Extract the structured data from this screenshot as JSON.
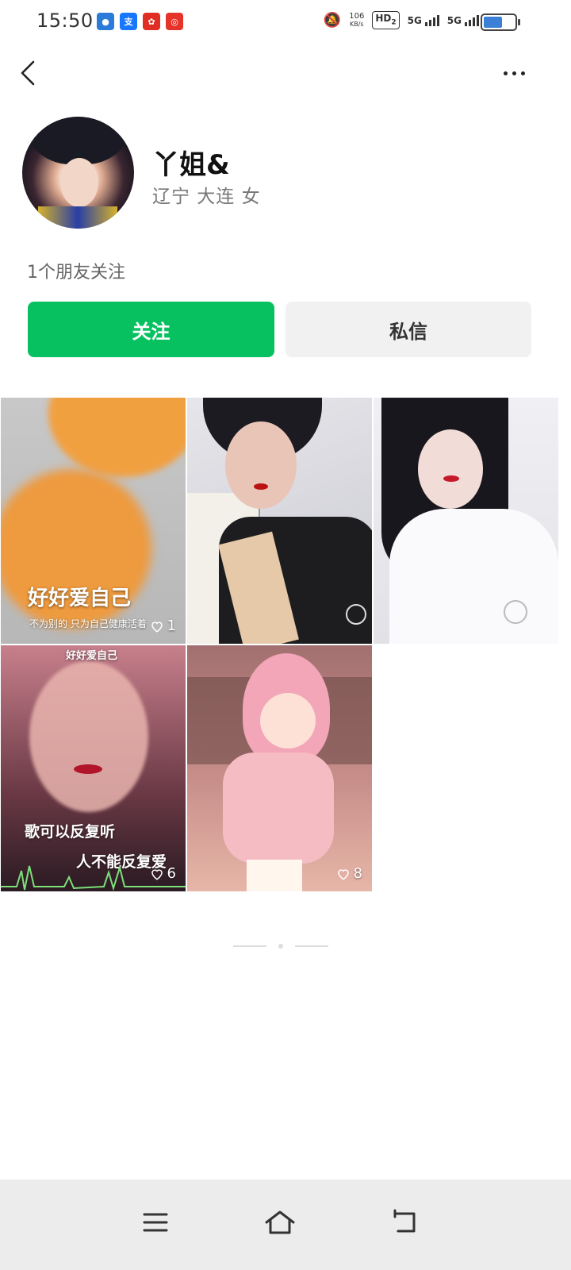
{
  "status_bar": {
    "time": "15:50",
    "net_speed_value": "106",
    "net_speed_unit": "KB/s",
    "hd_label": "HD",
    "hd_sub": "2",
    "signal1_label": "5G",
    "signal2_label": "5G",
    "battery_level": 0.65
  },
  "header": {
    "back_icon": "chevron-left-icon",
    "more_icon": "more-dots-icon"
  },
  "profile": {
    "name": "丫姐&",
    "location": "辽宁 大连 女",
    "friends_follow": "1个朋友关注",
    "follow_label": "关注",
    "message_label": "私信"
  },
  "posts": [
    {
      "caption_main": "好好爱自己",
      "caption_sub": "不为别的 只为自己健康活着",
      "likes": "1"
    },
    {
      "caption_main": "",
      "caption_sub": "",
      "likes": ""
    },
    {
      "caption_main": "",
      "caption_sub": "",
      "likes": ""
    },
    {
      "caption_top": "好好爱自己",
      "caption_main": "歌可以反复听",
      "caption_sub": "人不能反复爱",
      "likes": "6"
    },
    {
      "caption_main": "",
      "caption_sub": "",
      "likes": "8"
    }
  ],
  "colors": {
    "accent": "#07c160",
    "secondary_button": "#f1f1f1"
  }
}
